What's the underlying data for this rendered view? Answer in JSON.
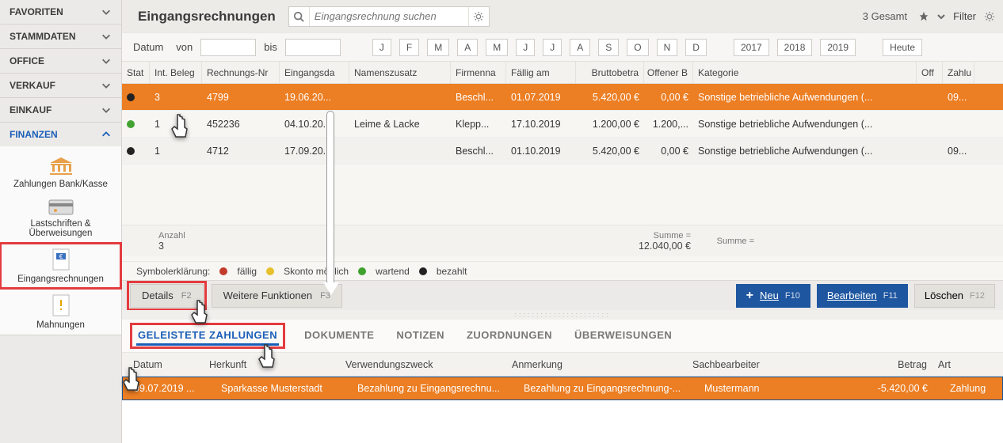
{
  "sidebar": {
    "groups": [
      "FAVORITEN",
      "STAMMDATEN",
      "OFFICE",
      "VERKAUF",
      "EINKAUF",
      "FINANZEN"
    ],
    "tiles": {
      "bank": "Zahlungen Bank/Kasse",
      "last": "Lastschriften & Überweisungen",
      "eing": "Eingangsrechnungen",
      "mahn": "Mahnungen"
    }
  },
  "toolbar": {
    "title": "Eingangsrechnungen",
    "search_placeholder": "Eingangsrechnung suchen",
    "count": "3 Gesamt",
    "filter": "Filter"
  },
  "filterbar": {
    "datum": "Datum",
    "von": "von",
    "bis": "bis",
    "months": [
      "J",
      "F",
      "M",
      "A",
      "M",
      "J",
      "J",
      "A",
      "S",
      "O",
      "N",
      "D"
    ],
    "years": [
      "2017",
      "2018",
      "2019"
    ],
    "today": "Heute"
  },
  "grid": {
    "headers": {
      "stat": "Stat",
      "beleg": "Int. Beleg",
      "rech": "Rechnungs-Nr",
      "eing": "Eingangsda",
      "namens": "Namenszusatz",
      "firm": "Firmenna",
      "faellig": "Fällig am",
      "brutto": "Bruttobetra",
      "offen": "Offener B",
      "kat": "Kategorie",
      "off2": "Off",
      "zahl": "Zahlu"
    },
    "rows": [
      {
        "status": "black",
        "beleg": "3",
        "rech": "4799",
        "eing": "19.06.20...",
        "namens": "",
        "firm": "Beschl...",
        "faellig": "01.07.2019",
        "brutto": "5.420,00 €",
        "offen": "0,00 €",
        "kat": "Sonstige betriebliche Aufwendungen (...",
        "off2": "",
        "zahl": "09..."
      },
      {
        "status": "green",
        "beleg": "1",
        "rech": "452236",
        "eing": "04.10.20...",
        "namens": "Leime & Lacke",
        "firm": "Klepp...",
        "faellig": "17.10.2019",
        "brutto": "1.200,00 €",
        "offen": "1.200,...",
        "kat": "Sonstige betriebliche Aufwendungen (...",
        "off2": "",
        "zahl": ""
      },
      {
        "status": "black",
        "beleg": "1",
        "rech": "4712",
        "eing": "17.09.20...",
        "namens": "",
        "firm": "Beschl...",
        "faellig": "01.10.2019",
        "brutto": "5.420,00 €",
        "offen": "0,00 €",
        "kat": "Sonstige betriebliche Aufwendungen (...",
        "off2": "",
        "zahl": "09..."
      }
    ],
    "summary": {
      "anzahl_lbl": "Anzahl",
      "anzahl_val": "3",
      "summe_lbl": "Summe =",
      "summe_val": "12.040,00 €",
      "summe2_lbl": "Summe ="
    }
  },
  "legend": {
    "title": "Symbolerklärung:",
    "faellig": "fällig",
    "skonto": "Skonto möglich",
    "wartend": "wartend",
    "bezahlt": "bezahlt"
  },
  "actions": {
    "details": "Details",
    "details_k": "F2",
    "wf": "Weitere Funktionen",
    "wf_k": "F3",
    "neu": "Neu",
    "neu_k": "F10",
    "bearb": "Bearbeiten",
    "bearb_k": "F11",
    "loesch": "Löschen",
    "loesch_k": "F12"
  },
  "tabs": {
    "gz": "GELEISTETE ZAHLUNGEN",
    "dok": "DOKUMENTE",
    "not": "NOTIZEN",
    "zuo": "ZUORDNUNGEN",
    "ueb": "ÜBERWEISUNGEN"
  },
  "payhead": {
    "datum": "Datum",
    "her": "Herkunft",
    "verw": "Verwendungszweck",
    "anm": "Anmerkung",
    "sach": "Sachbearbeiter",
    "betrag": "Betrag",
    "art": "Art"
  },
  "payrow": {
    "datum": "09.07.2019 ...",
    "her": "Sparkasse Musterstadt",
    "verw": "Bezahlung zu Eingangsrechnu...",
    "anm": "Bezahlung zu Eingangsrechnung-...",
    "sach": "Mustermann",
    "betrag": "-5.420,00 €",
    "art": "Zahlung"
  }
}
